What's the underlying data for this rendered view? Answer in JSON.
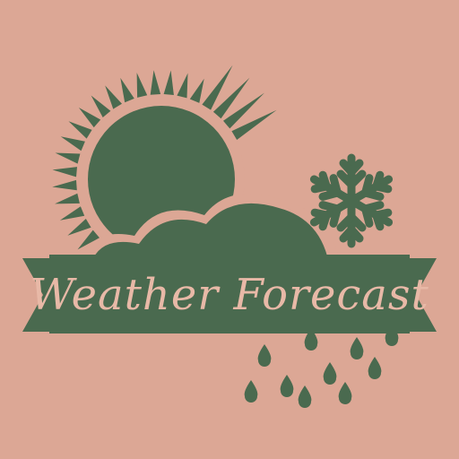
{
  "colors": {
    "background": "#DCA795",
    "primary": "#4A6A4F",
    "text": "#E8B9A7"
  },
  "logo": {
    "title": "Weather Forecast",
    "icons": [
      "sun-icon",
      "cloud-icon",
      "snowflake-icon",
      "raindrops-icon"
    ]
  }
}
